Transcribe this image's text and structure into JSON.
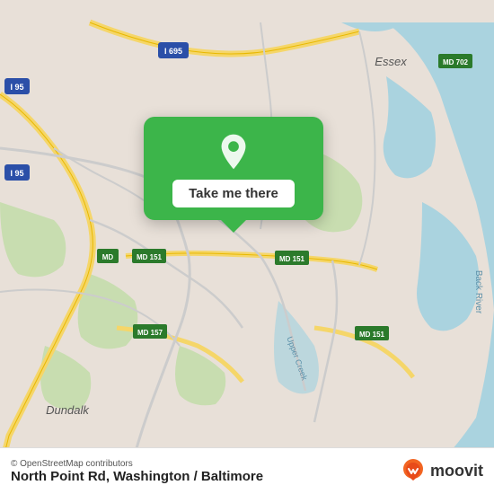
{
  "map": {
    "alt": "Map of North Point Rd, Washington / Baltimore area"
  },
  "popup": {
    "button_label": "Take me there"
  },
  "bottom_bar": {
    "copyright": "© OpenStreetMap contributors",
    "location_title": "North Point Rd, Washington / Baltimore",
    "moovit_text": "moovit"
  }
}
